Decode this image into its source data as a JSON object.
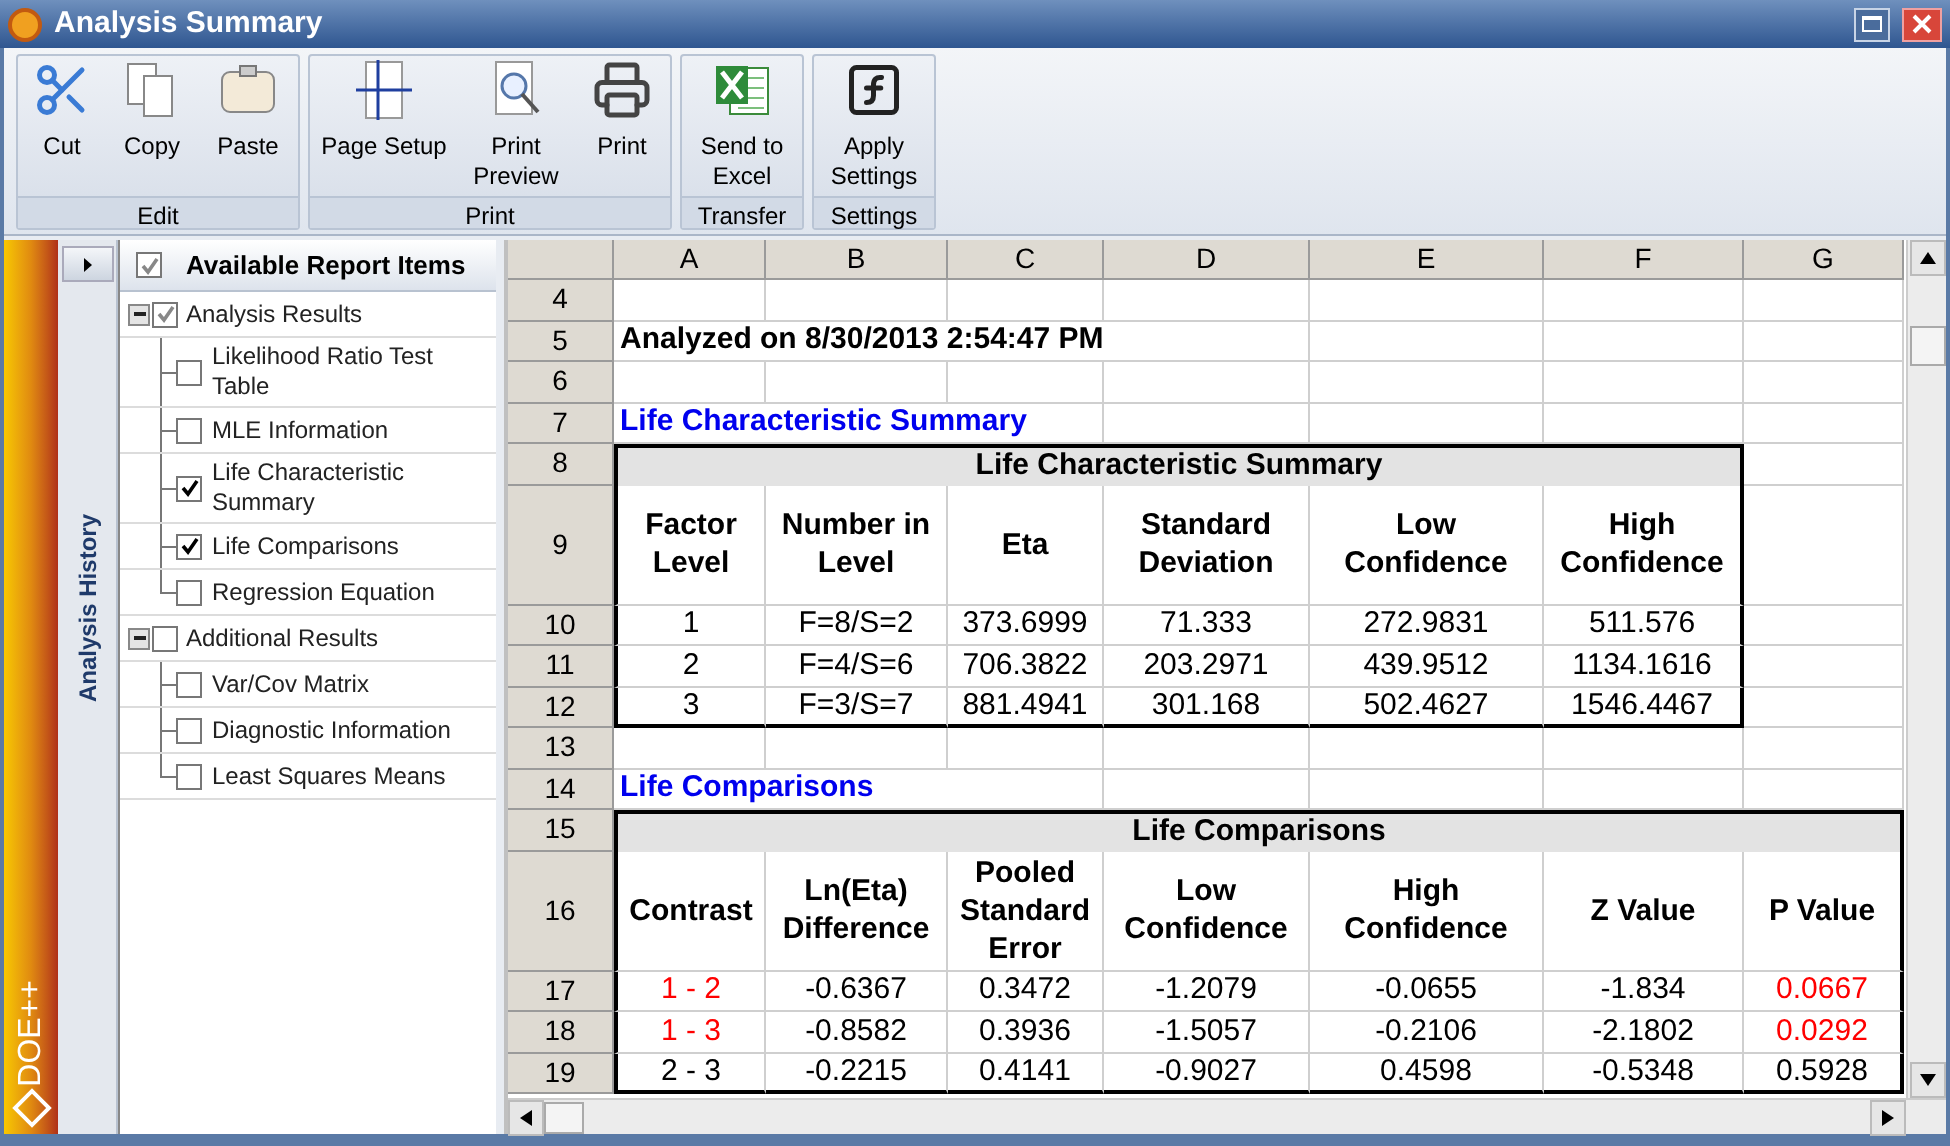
{
  "window": {
    "title": "Analysis Summary"
  },
  "ribbon": {
    "groups": [
      {
        "label": "Edit",
        "buttons": [
          {
            "label": "Cut"
          },
          {
            "label": "Copy"
          },
          {
            "label": "Paste"
          }
        ]
      },
      {
        "label": "Print",
        "buttons": [
          {
            "label": "Page Setup"
          },
          {
            "label": "Print Preview"
          },
          {
            "label": "Print"
          }
        ]
      },
      {
        "label": "Transfer",
        "buttons": [
          {
            "label": "Send to Excel"
          }
        ]
      },
      {
        "label": "Settings",
        "buttons": [
          {
            "label": "Apply Settings"
          }
        ]
      }
    ]
  },
  "sidebar": {
    "brand": "DOE++",
    "history_tab": "Analysis History"
  },
  "report_items": {
    "title": "Available Report Items",
    "checked": true,
    "groups": [
      {
        "label": "Analysis Results",
        "expanded": true,
        "checked": true,
        "children": [
          {
            "label": "Likelihood Ratio Test Table",
            "checked": false
          },
          {
            "label": "MLE Information",
            "checked": false
          },
          {
            "label": "Life Characteristic Summary",
            "checked": true
          },
          {
            "label": "Life Comparisons",
            "checked": true
          },
          {
            "label": "Regression Equation",
            "checked": false
          }
        ]
      },
      {
        "label": "Additional Results",
        "expanded": true,
        "checked": false,
        "children": [
          {
            "label": "Var/Cov Matrix",
            "checked": false
          },
          {
            "label": "Diagnostic Information",
            "checked": false
          },
          {
            "label": "Least Squares Means",
            "checked": false
          }
        ]
      }
    ]
  },
  "sheet": {
    "columns": [
      "A",
      "B",
      "C",
      "D",
      "E",
      "F",
      "G"
    ],
    "rows": [
      {
        "number": "4",
        "kind": "blank"
      },
      {
        "number": "5",
        "kind": "note",
        "text": "Analyzed on 8/30/2013 2:54:47 PM"
      },
      {
        "number": "6",
        "kind": "blank"
      },
      {
        "number": "7",
        "kind": "section",
        "text": "Life Characteristic Summary"
      },
      {
        "number": "8",
        "kind": "table_title",
        "text": "Life Characteristic Summary"
      },
      {
        "number": "9",
        "kind": "header",
        "cells": [
          "Factor Level",
          "Number in Level",
          "Eta",
          "Standard Deviation",
          "Low Confidence",
          "High Confidence"
        ]
      },
      {
        "number": "10",
        "kind": "data",
        "cells": [
          {
            "text": "1",
            "flagged": false
          },
          {
            "text": "F=8/S=2",
            "flagged": false
          },
          {
            "text": "373.6999",
            "flagged": false
          },
          {
            "text": "71.333",
            "flagged": false
          },
          {
            "text": "272.9831",
            "flagged": false
          },
          {
            "text": "511.576",
            "flagged": false
          }
        ]
      },
      {
        "number": "11",
        "kind": "data",
        "cells": [
          {
            "text": "2",
            "flagged": false
          },
          {
            "text": "F=4/S=6",
            "flagged": false
          },
          {
            "text": "706.3822",
            "flagged": false
          },
          {
            "text": "203.2971",
            "flagged": false
          },
          {
            "text": "439.9512",
            "flagged": false
          },
          {
            "text": "1134.1616",
            "flagged": false
          }
        ]
      },
      {
        "number": "12",
        "kind": "data",
        "cells": [
          {
            "text": "3",
            "flagged": false
          },
          {
            "text": "F=3/S=7",
            "flagged": false
          },
          {
            "text": "881.4941",
            "flagged": false
          },
          {
            "text": "301.168",
            "flagged": false
          },
          {
            "text": "502.4627",
            "flagged": false
          },
          {
            "text": "1546.4467",
            "flagged": false
          }
        ]
      },
      {
        "number": "13",
        "kind": "blank"
      },
      {
        "number": "14",
        "kind": "section",
        "text": "Life Comparisons"
      },
      {
        "number": "15",
        "kind": "table_title",
        "text": "Life Comparisons"
      },
      {
        "number": "16",
        "kind": "header",
        "cells": [
          "Contrast",
          "Ln(Eta) Difference",
          "Pooled Standard Error",
          "Low Confidence",
          "High Confidence",
          "Z Value",
          "P Value"
        ]
      },
      {
        "number": "17",
        "kind": "data",
        "cells": [
          {
            "text": "1 - 2",
            "flagged": true
          },
          {
            "text": "-0.6367",
            "flagged": false
          },
          {
            "text": "0.3472",
            "flagged": false
          },
          {
            "text": "-1.2079",
            "flagged": false
          },
          {
            "text": "-0.0655",
            "flagged": false
          },
          {
            "text": "-1.834",
            "flagged": false
          },
          {
            "text": "0.0667",
            "flagged": true
          }
        ]
      },
      {
        "number": "18",
        "kind": "data",
        "cells": [
          {
            "text": "1 - 3",
            "flagged": true
          },
          {
            "text": "-0.8582",
            "flagged": false
          },
          {
            "text": "0.3936",
            "flagged": false
          },
          {
            "text": "-1.5057",
            "flagged": false
          },
          {
            "text": "-0.2106",
            "flagged": false
          },
          {
            "text": "-2.1802",
            "flagged": false
          },
          {
            "text": "0.0292",
            "flagged": true
          }
        ]
      },
      {
        "number": "19",
        "kind": "data",
        "cells": [
          {
            "text": "2 - 3",
            "flagged": false
          },
          {
            "text": "-0.2215",
            "flagged": false
          },
          {
            "text": "0.4141",
            "flagged": false
          },
          {
            "text": "-0.9027",
            "flagged": false
          },
          {
            "text": "0.4598",
            "flagged": false
          },
          {
            "text": "-0.5348",
            "flagged": false
          },
          {
            "text": "0.5928",
            "flagged": false
          }
        ]
      }
    ]
  }
}
